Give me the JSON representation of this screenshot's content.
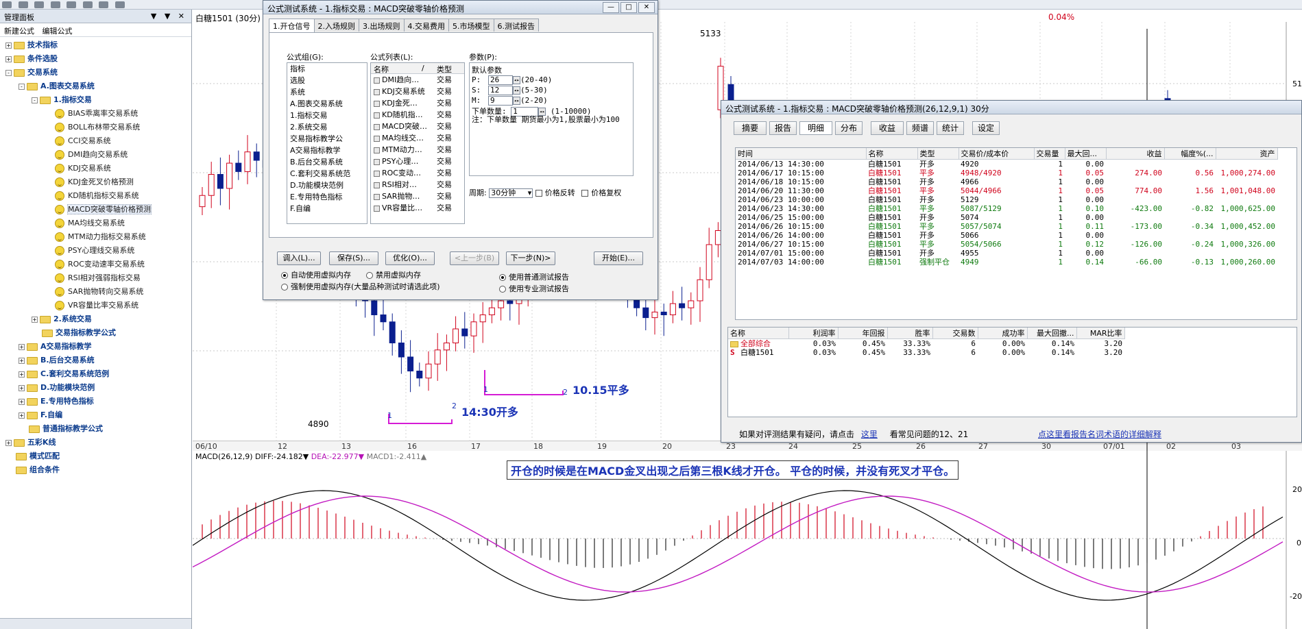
{
  "toolbar": {
    "icons": [
      "save-icon",
      "new-icon",
      "open-icon",
      "undo-icon",
      "redo-icon",
      "draw-icon",
      "edit-icon",
      "select-icon"
    ]
  },
  "left_panel": {
    "title": "管理面板",
    "controls": "▼ ▼ ✕",
    "menu": [
      "新建公式",
      "编辑公式"
    ],
    "tree": [
      {
        "label": "技术指标",
        "level": 0,
        "kind": "folder",
        "expand": "+",
        "bold": true
      },
      {
        "label": "条件选股",
        "level": 0,
        "kind": "folder",
        "expand": "+",
        "bold": true
      },
      {
        "label": "交易系统",
        "level": 0,
        "kind": "folder",
        "expand": "-",
        "bold": true
      },
      {
        "label": "A.图表交易系统",
        "level": 1,
        "kind": "folder",
        "expand": "-",
        "bold": true
      },
      {
        "label": "1.指标交易",
        "level": 2,
        "kind": "folder",
        "expand": "-",
        "bold": true
      },
      {
        "label": "BIAS乖离率交易系统",
        "level": 3,
        "kind": "smile"
      },
      {
        "label": "BOLL布林带交易系统",
        "level": 3,
        "kind": "smile"
      },
      {
        "label": "CCI交易系统",
        "level": 3,
        "kind": "smile"
      },
      {
        "label": "DMI趋向交易系统",
        "level": 3,
        "kind": "smile"
      },
      {
        "label": "KDJ交易系统",
        "level": 3,
        "kind": "smile"
      },
      {
        "label": "KDJ金死叉价格预测",
        "level": 3,
        "kind": "smile"
      },
      {
        "label": "KD随机指标交易系统",
        "level": 3,
        "kind": "smile"
      },
      {
        "label": "MACD突破零轴价格预测",
        "level": 3,
        "kind": "smile",
        "selected": true
      },
      {
        "label": "MA均线交易系统",
        "level": 3,
        "kind": "smile"
      },
      {
        "label": "MTM动力指标交易系统",
        "level": 3,
        "kind": "smile"
      },
      {
        "label": "PSY心理线交易系统",
        "level": 3,
        "kind": "smile"
      },
      {
        "label": "ROC变动速率交易系统",
        "level": 3,
        "kind": "smile"
      },
      {
        "label": "RSI相对强弱指标交易",
        "level": 3,
        "kind": "smile"
      },
      {
        "label": "SAR抛物转向交易系统",
        "level": 3,
        "kind": "smile"
      },
      {
        "label": "VR容量比率交易系统",
        "level": 3,
        "kind": "smile"
      },
      {
        "label": "2.系统交易",
        "level": 2,
        "kind": "folder",
        "expand": "+",
        "bold": true
      },
      {
        "label": "交易指标教学公式",
        "level": 2,
        "kind": "folder",
        "bold": true
      },
      {
        "label": "A交易指标教学",
        "level": 1,
        "kind": "folder",
        "expand": "+",
        "bold": true
      },
      {
        "label": "B.后台交易系统",
        "level": 1,
        "kind": "folder",
        "expand": "+",
        "bold": true
      },
      {
        "label": "C.套利交易系统范例",
        "level": 1,
        "kind": "folder",
        "expand": "+",
        "bold": true
      },
      {
        "label": "D.功能模块范例",
        "level": 1,
        "kind": "folder",
        "expand": "+",
        "bold": true
      },
      {
        "label": "E.专用特色指标",
        "level": 1,
        "kind": "folder",
        "expand": "+",
        "bold": true
      },
      {
        "label": "F.自编",
        "level": 1,
        "kind": "folder",
        "expand": "+",
        "bold": true
      },
      {
        "label": "普通指标教学公式",
        "level": 1,
        "kind": "folder",
        "bold": true
      },
      {
        "label": "五彩K线",
        "level": 0,
        "kind": "folder",
        "expand": "+",
        "bold": true
      },
      {
        "label": "模式匹配",
        "level": 0,
        "kind": "folder",
        "bold": true
      },
      {
        "label": "组合条件",
        "level": 0,
        "kind": "folder",
        "bold": true
      }
    ]
  },
  "chart": {
    "title": "白糖1501 (30分)",
    "pct": "0.04%",
    "high_label": "5133",
    "low_label": "4890",
    "right_axis_top": "51",
    "right_axis_macd": [
      "20",
      "0",
      "-20"
    ],
    "dates": [
      "06/10",
      "12",
      "13",
      "16",
      "17",
      "18",
      "19",
      "20",
      "23",
      "24",
      "25",
      "26",
      "27",
      "30",
      "07/01",
      "02",
      "03"
    ],
    "macd_label_1": "MACD(26,12,9) DIFF:-24.182▼",
    "macd_label_2": "DEA:-22.977▼",
    "macd_label_3": "MACD1:-2.411▲",
    "annot_1_time": "14:30开多",
    "annot_2_time": "10.15平多",
    "marker_1a": "1",
    "marker_1b": "2",
    "marker_2a": "1",
    "marker_2b": "2",
    "note": "开仓的时候是在MACD金叉出现之后第三根K线才开仓。 平仓的时候，并没有死叉才平仓。",
    "colors": {
      "up": "#d0021b",
      "down": "#0a1f8f",
      "diff": "#000000",
      "dea": "#c21ac2",
      "annot": "#1b34b6",
      "magenta": "#d51bd5"
    }
  },
  "dialog1": {
    "title": "公式测试系统 - 1.指标交易 : MACD突破零轴价格预测",
    "tabs": [
      "1.开仓信号",
      "2.入场规则",
      "3.出场规则",
      "4.交易费用",
      "5.市场模型",
      "6.测试报告"
    ],
    "group_label": "公式组(G):",
    "group_items": [
      "指标",
      "选股",
      "系统",
      "A.图表交易系统",
      "1.指标交易",
      "2.系统交易",
      "交易指标教学公",
      "A交易指标教学",
      "B.后台交易系统",
      "C.套利交易系统范",
      "D.功能模块范例",
      "E.专用特色指标",
      "F.自编"
    ],
    "list_label": "公式列表(L):",
    "list_headers": [
      "名称",
      "/",
      "类型"
    ],
    "list_items": [
      {
        "name": "DMI趋向…",
        "type": "交易"
      },
      {
        "name": "KDJ交易系统",
        "type": "交易"
      },
      {
        "name": "KDJ金死…",
        "type": "交易"
      },
      {
        "name": "KD随机指…",
        "type": "交易"
      },
      {
        "name": "MACD突破…",
        "type": "交易"
      },
      {
        "name": "MA均线交…",
        "type": "交易"
      },
      {
        "name": "MTM动力…",
        "type": "交易"
      },
      {
        "name": "PSY心理…",
        "type": "交易"
      },
      {
        "name": "ROC变动…",
        "type": "交易"
      },
      {
        "name": "RSI相对…",
        "type": "交易"
      },
      {
        "name": "SAR抛物…",
        "type": "交易"
      },
      {
        "name": "VR容量比…",
        "type": "交易"
      }
    ],
    "params_label": "参数(P):",
    "default_params": "默认参数",
    "params": [
      {
        "name": "P:",
        "value": "26",
        "range": "(20-40)"
      },
      {
        "name": "S:",
        "value": "12",
        "range": "(5-30)"
      },
      {
        "name": "M:",
        "value": "9",
        "range": "(2-20)"
      }
    ],
    "order_qty_label": "下单数量:",
    "order_qty": "1",
    "order_range": "(1-10000)",
    "note": "注：下单数量 期货最小为1,股票最小为100",
    "period_label": "周期:",
    "period_value": "30分钟",
    "chk_reverse": "价格反转",
    "chk_restore": "价格复权",
    "buttons": {
      "load": "调入(L)...",
      "save": "保存(S)...",
      "optimize": "优化(O)...",
      "prev": "<上一步(B)",
      "next": "下一步(N)>",
      "start": "开始(E)..."
    },
    "radio_1": "自动使用虚拟内存",
    "radio_2": "禁用虚拟内存",
    "radio_3": "强制使用虚拟内存(大量品种测试时请选此项)",
    "radio_4": "使用普通测试报告",
    "radio_5": "使用专业测试报告"
  },
  "dialog2": {
    "title": "公式测试系统 - 1.指标交易 : MACD突破零轴价格预测(26,12,9,1) 30分",
    "tabs": [
      "摘要",
      "报告",
      "明细",
      "分布",
      "收益",
      "频谱",
      "统计",
      "设定"
    ],
    "detail_headers": [
      "时间",
      "名称",
      "类型",
      "交易价/成本价",
      "交易量",
      "最大回...",
      "收益",
      "幅度%(...",
      "资产"
    ],
    "detail_rows": [
      {
        "time": "2014/06/13 14:30:00",
        "name": "白糖1501",
        "type": "开多",
        "price": "4920",
        "qty": "1",
        "dd": "0.00",
        "profit": "",
        "pct": "",
        "asset": "",
        "c": "black"
      },
      {
        "time": "2014/06/17 10:15:00",
        "name": "白糖1501",
        "type": "平多",
        "price": "4948/4920",
        "qty": "1",
        "dd": "0.05",
        "profit": "274.00",
        "pct": "0.56",
        "asset": "1,000,274.00",
        "c": "red"
      },
      {
        "time": "2014/06/18 10:15:00",
        "name": "白糖1501",
        "type": "开多",
        "price": "4966",
        "qty": "1",
        "dd": "0.00",
        "profit": "",
        "pct": "",
        "asset": "",
        "c": "black"
      },
      {
        "time": "2014/06/20 11:30:00",
        "name": "白糖1501",
        "type": "平多",
        "price": "5044/4966",
        "qty": "1",
        "dd": "0.05",
        "profit": "774.00",
        "pct": "1.56",
        "asset": "1,001,048.00",
        "c": "red"
      },
      {
        "time": "2014/06/23 10:00:00",
        "name": "白糖1501",
        "type": "开多",
        "price": "5129",
        "qty": "1",
        "dd": "0.00",
        "profit": "",
        "pct": "",
        "asset": "",
        "c": "black"
      },
      {
        "time": "2014/06/23 14:30:00",
        "name": "白糖1501",
        "type": "平多",
        "price": "5087/5129",
        "qty": "1",
        "dd": "0.10",
        "profit": "-423.00",
        "pct": "-0.82",
        "asset": "1,000,625.00",
        "c": "green"
      },
      {
        "time": "2014/06/25 15:00:00",
        "name": "白糖1501",
        "type": "开多",
        "price": "5074",
        "qty": "1",
        "dd": "0.00",
        "profit": "",
        "pct": "",
        "asset": "",
        "c": "black"
      },
      {
        "time": "2014/06/26 10:15:00",
        "name": "白糖1501",
        "type": "平多",
        "price": "5057/5074",
        "qty": "1",
        "dd": "0.11",
        "profit": "-173.00",
        "pct": "-0.34",
        "asset": "1,000,452.00",
        "c": "green"
      },
      {
        "time": "2014/06/26 14:00:00",
        "name": "白糖1501",
        "type": "开多",
        "price": "5066",
        "qty": "1",
        "dd": "0.00",
        "profit": "",
        "pct": "",
        "asset": "",
        "c": "black"
      },
      {
        "time": "2014/06/27 10:15:00",
        "name": "白糖1501",
        "type": "平多",
        "price": "5054/5066",
        "qty": "1",
        "dd": "0.12",
        "profit": "-126.00",
        "pct": "-0.24",
        "asset": "1,000,326.00",
        "c": "green"
      },
      {
        "time": "2014/07/01 15:00:00",
        "name": "白糖1501",
        "type": "开多",
        "price": "4955",
        "qty": "1",
        "dd": "0.00",
        "profit": "",
        "pct": "",
        "asset": "",
        "c": "black"
      },
      {
        "time": "2014/07/03 14:00:00",
        "name": "白糖1501",
        "type": "强制平仓",
        "price": "4949",
        "qty": "1",
        "dd": "0.14",
        "profit": "-66.00",
        "pct": "-0.13",
        "asset": "1,000,260.00",
        "c": "green"
      }
    ],
    "summary_headers": [
      "名称",
      "利润率",
      "年回报",
      "胜率",
      "交易数",
      "成功率",
      "最大回撤...",
      "MAR比率"
    ],
    "summary_rows": [
      {
        "icon": "folder",
        "name": "全部综合",
        "profit": "0.03%",
        "annual": "0.45%",
        "win": "33.33%",
        "trades": "6",
        "success": "0.00%",
        "maxdd": "0.14%",
        "mar": "3.20",
        "c": "red"
      },
      {
        "icon": "S",
        "name": "白糖1501",
        "profit": "0.03%",
        "annual": "0.45%",
        "win": "33.33%",
        "trades": "6",
        "success": "0.00%",
        "maxdd": "0.14%",
        "mar": "3.20",
        "c": "black"
      }
    ],
    "footer_text": "如果对评测结果有疑问，请点击",
    "footer_link": "这里",
    "footer_text2": "看常见问题的12、21",
    "footer_link2": "点这里看报告名词术语的详细解释"
  }
}
